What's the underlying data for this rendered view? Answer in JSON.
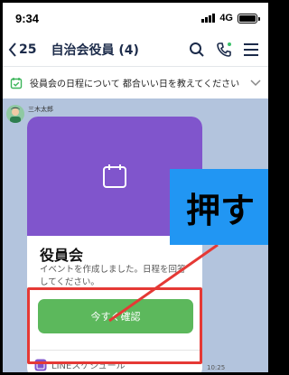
{
  "status_bar": {
    "time": "9:34",
    "network": "4G"
  },
  "header": {
    "back_count": "25",
    "chat_title": "自治会役員 (4)",
    "icons": [
      "search-icon",
      "phone-icon",
      "menu-icon"
    ]
  },
  "announcement": {
    "icon": "calendar-check-icon",
    "text": "役員会の日程について 都合いい日を教えてください"
  },
  "message": {
    "sender": "三木太郎",
    "time": "10:25",
    "card": {
      "icon": "calendar-icon",
      "title": "役員会",
      "description": "イベントを作成しました。日程を回答してください。",
      "button_label": "今すぐ確認",
      "footer_label": "LINEスケジュール"
    }
  },
  "annotation": {
    "label": "押す",
    "box_color": "#e53935",
    "label_bg": "#2196f3"
  },
  "colors": {
    "chat_bg": "#b3c4dd",
    "card_header": "#8055cc",
    "button": "#5cb85c"
  }
}
